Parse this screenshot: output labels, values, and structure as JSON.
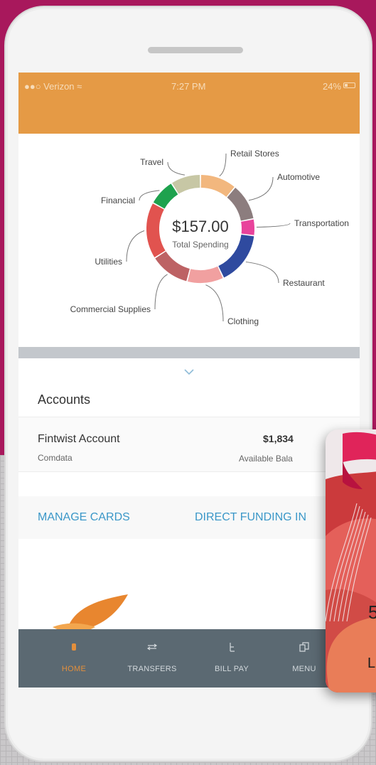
{
  "status_bar": {
    "carrier": "Verizon",
    "time": "7:27 PM",
    "battery": "24%"
  },
  "chart_data": {
    "type": "pie",
    "style": "donut",
    "center_value": "$157.00",
    "center_label": "Total Spending",
    "categories": [
      "Retail Stores",
      "Automotive",
      "Transportation",
      "Restaurant",
      "Clothing",
      "Commercial Supplies",
      "Utilities",
      "Financial",
      "Travel"
    ],
    "values": [
      11,
      11,
      5,
      16,
      11,
      12,
      17,
      8,
      9
    ],
    "colors": [
      "#f2b77e",
      "#8c7d7e",
      "#e8439b",
      "#2f4a9f",
      "#f1a0a0",
      "#bd6264",
      "#e1534f",
      "#1ea24e",
      "#c7c7a5"
    ],
    "legend": "callout-labels"
  },
  "accounts": {
    "title": "Accounts",
    "name": "Fintwist Account",
    "issuer": "Comdata",
    "balance": "$1,834",
    "balance_label": "Available Bala"
  },
  "links": {
    "manage_cards": "MANAGE CARDS",
    "direct_funding": "DIRECT FUNDING IN"
  },
  "tabs": [
    {
      "label": "HOME",
      "icon": "home-icon"
    },
    {
      "label": "TRANSFERS",
      "icon": "transfers-icon"
    },
    {
      "label": "BILL PAY",
      "icon": "bill-pay-icon"
    },
    {
      "label": "MENU",
      "icon": "menu-icon"
    }
  ],
  "card": {
    "number_fragment": "5",
    "name_fragment": "L"
  },
  "colors": {
    "accent": "#e59a45",
    "link": "#3a97c8",
    "tabbar": "#5b6972",
    "background": "#a8185c"
  }
}
